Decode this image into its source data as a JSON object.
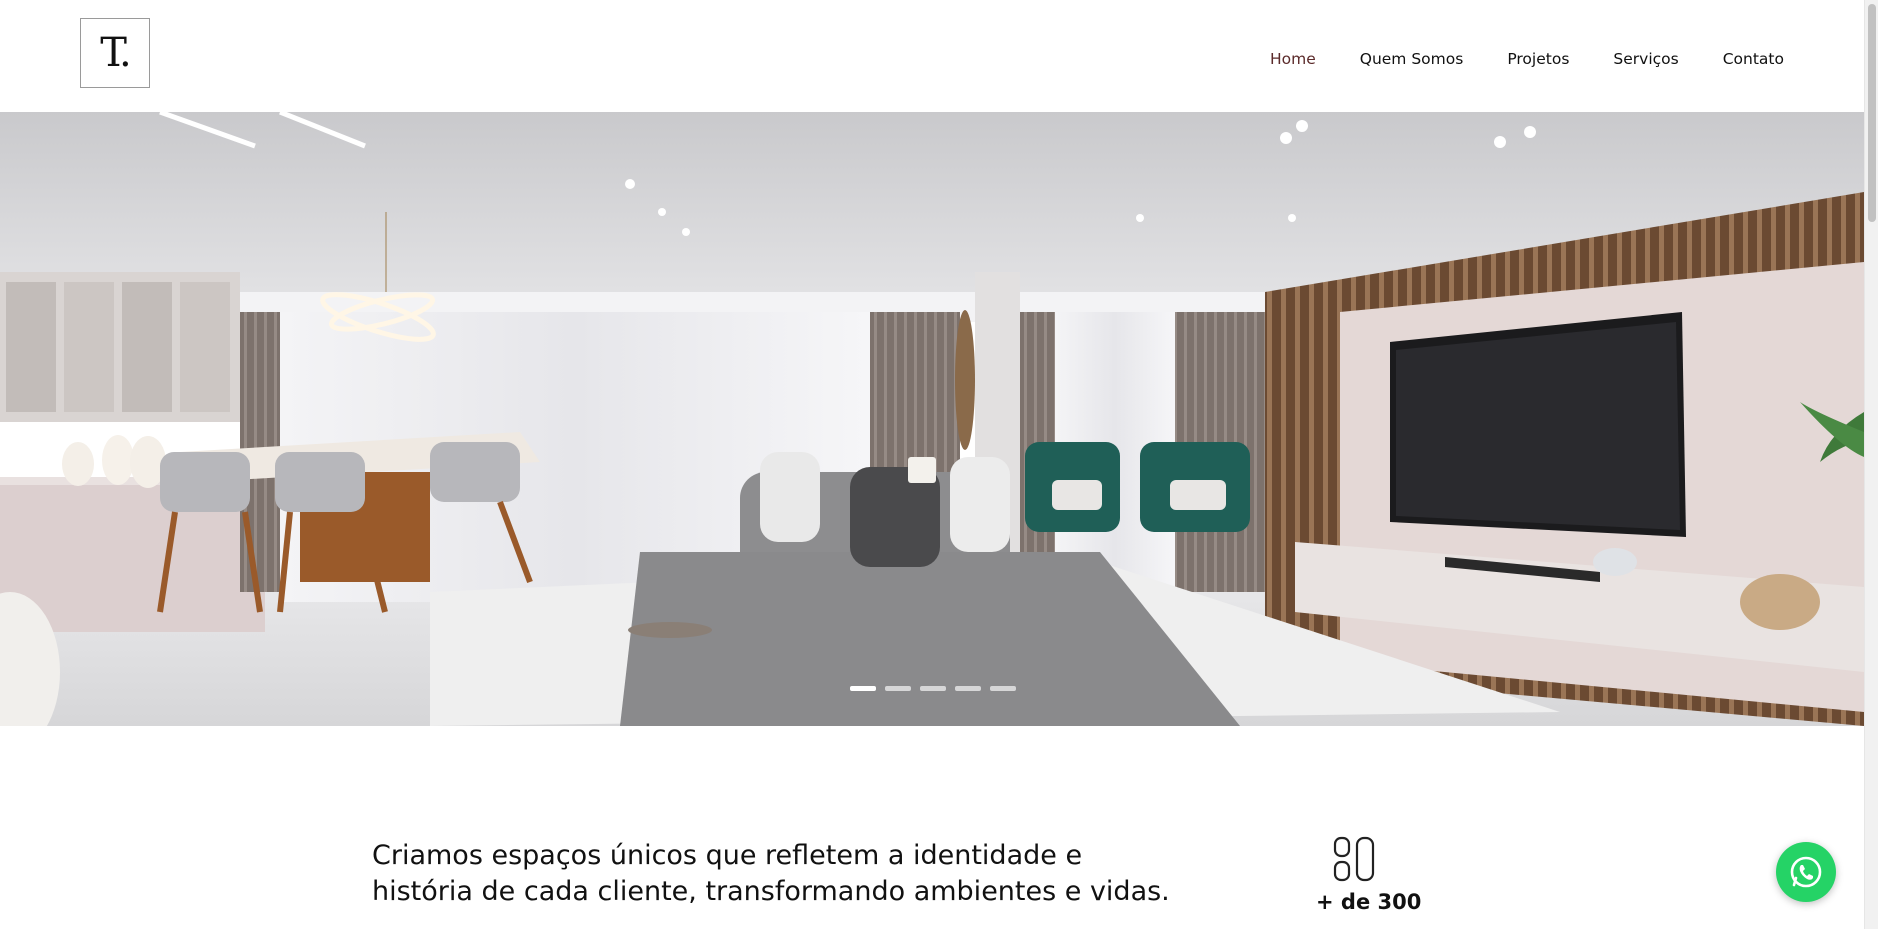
{
  "header": {
    "logo_letter": "T.",
    "nav": [
      {
        "label": "Home",
        "active": true
      },
      {
        "label": "Quem Somos",
        "active": false
      },
      {
        "label": "Projetos",
        "active": false
      },
      {
        "label": "Serviços",
        "active": false
      },
      {
        "label": "Contato",
        "active": false
      }
    ]
  },
  "hero": {
    "slide_count": 5,
    "active_slide": 1
  },
  "intro": {
    "text_line1": "Criamos espaços únicos que refletem a identidade e",
    "text_line2": "história de cada cliente, transformando ambientes e vidas."
  },
  "stats": {
    "icon": "layout-grid-icon",
    "value": "+ de 300"
  },
  "whatsapp": {
    "icon": "whatsapp-icon",
    "color": "#25d366"
  },
  "colors": {
    "nav_active": "#5b2a2a",
    "text": "#111111"
  }
}
